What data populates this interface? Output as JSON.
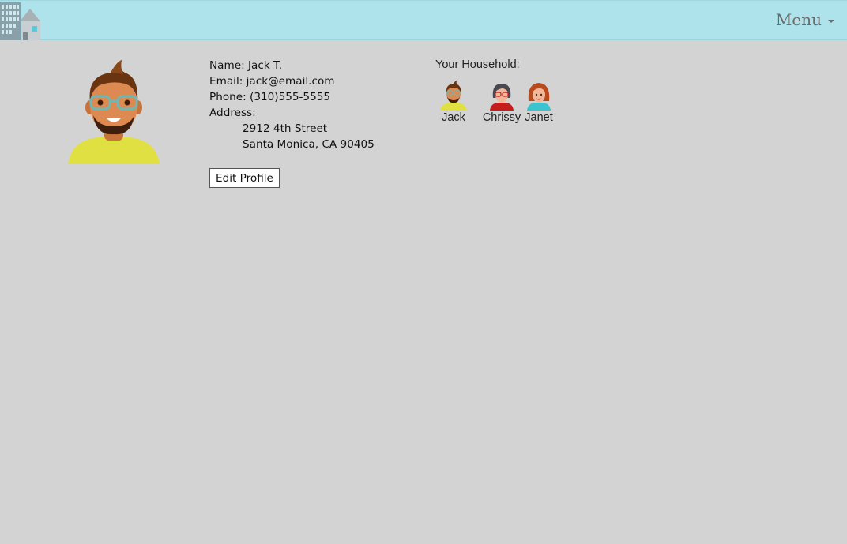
{
  "header": {
    "menu_label": "Menu",
    "background_color": "#aee3ec"
  },
  "logo": {
    "icon": "building-house-logo-icon"
  },
  "profile": {
    "avatar_icon": "man-with-glasses-avatar-icon",
    "name_line": "Name: Jack T.",
    "email_line": "Email: jack@email.com",
    "phone_line": "Phone: (310)555-5555",
    "address_label": "Address:",
    "address_line1": "2912 4th Street",
    "address_line2": "Santa Monica, CA 90405",
    "edit_button": "Edit Profile"
  },
  "household": {
    "title": "Your Household:",
    "members": [
      {
        "name": "Jack",
        "icon": "man-with-glasses-avatar-icon",
        "shirt_color": "#e0e043"
      },
      {
        "name": "Chrissy",
        "icon": "woman-with-glasses-avatar-icon",
        "shirt_color": "#c51c1c"
      },
      {
        "name": "Janet",
        "icon": "woman-red-hair-avatar-icon",
        "shirt_color": "#3cc3d0"
      }
    ]
  }
}
